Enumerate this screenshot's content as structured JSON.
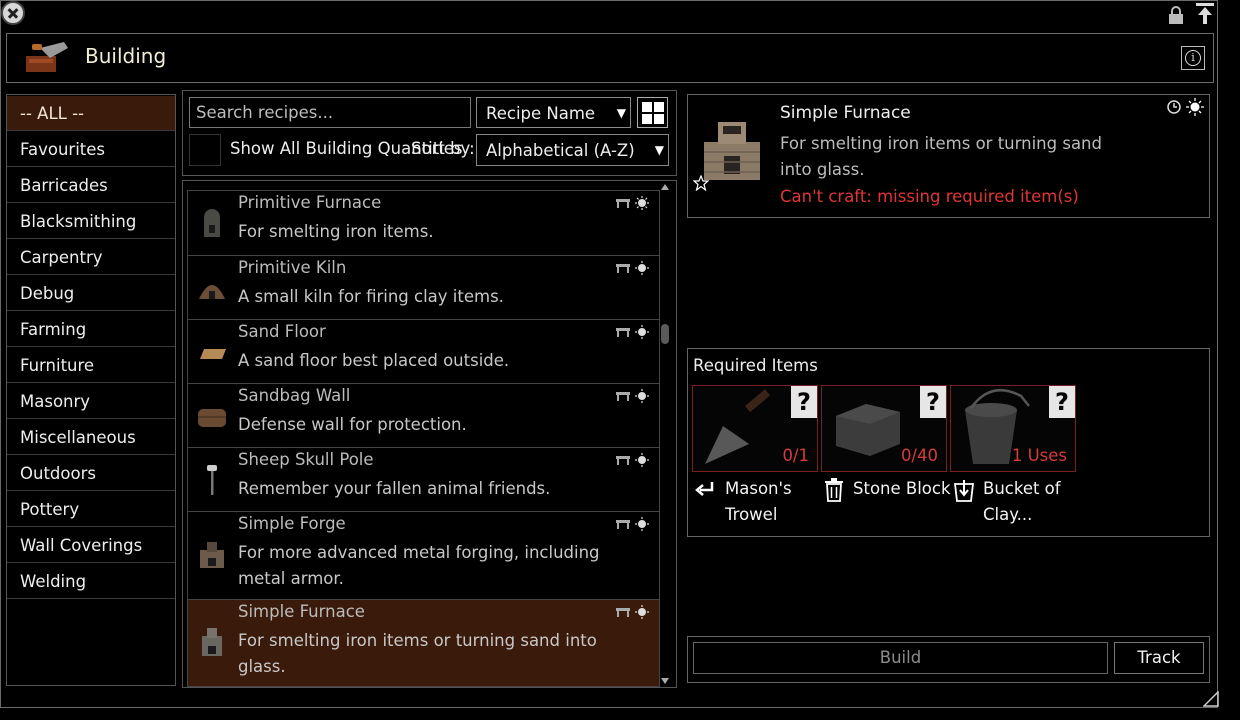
{
  "window": {
    "title": "Building",
    "icons": [
      "close-icon",
      "lock-icon",
      "pin-icon",
      "info-icon",
      "trowel-brick-icon"
    ]
  },
  "categories": [
    {
      "label": "-- ALL --",
      "active": true
    },
    {
      "label": "Favourites"
    },
    {
      "label": "Barricades"
    },
    {
      "label": "Blacksmithing"
    },
    {
      "label": "Carpentry"
    },
    {
      "label": "Debug"
    },
    {
      "label": "Farming"
    },
    {
      "label": "Furniture"
    },
    {
      "label": "Masonry"
    },
    {
      "label": "Miscellaneous"
    },
    {
      "label": "Outdoors"
    },
    {
      "label": "Pottery"
    },
    {
      "label": "Wall Coverings"
    },
    {
      "label": "Welding"
    }
  ],
  "controls": {
    "search_placeholder": "Search recipes...",
    "filter_select": "Recipe Name",
    "show_all_label": "Show All Building Quantities",
    "sort_by_label": "Sort by:",
    "sort_select": "Alphabetical (A-Z)"
  },
  "recipes": [
    {
      "name": "Primitive Furnace",
      "desc": "For smelting iron items.",
      "icon": "furnace-icon"
    },
    {
      "name": "Primitive Kiln",
      "desc": "A small kiln for firing clay items.",
      "icon": "kiln-icon"
    },
    {
      "name": "Sand Floor",
      "desc": "A sand floor best placed outside.",
      "icon": "sand-floor-icon"
    },
    {
      "name": "Sandbag Wall",
      "desc": "Defense wall for protection.",
      "icon": "sandbag-icon"
    },
    {
      "name": "Sheep Skull Pole",
      "desc": "Remember your fallen animal friends.",
      "icon": "skull-pole-icon"
    },
    {
      "name": "Simple Forge",
      "desc": "For more advanced metal forging, including metal armor.",
      "icon": "forge-icon"
    },
    {
      "name": "Simple Furnace",
      "desc": "For smelting iron items or turning sand into glass.",
      "icon": "furnace-icon",
      "selected": true
    }
  ],
  "detail": {
    "name": "Simple Furnace",
    "desc": "For smelting iron items or turning sand into glass.",
    "error": "Can't craft: missing required item(s)",
    "error_color": "#e03535"
  },
  "required": {
    "title": "Required Items",
    "items": [
      {
        "name": "Mason's Trowel",
        "count": "0/1",
        "badge": "?",
        "icon": "trowel-icon",
        "label_icon": "return-arrow-icon"
      },
      {
        "name": "Stone Block",
        "count": "0/40",
        "badge": "?",
        "icon": "stone-block-icon",
        "label_icon": "trash-icon"
      },
      {
        "name": "Bucket of Clay...",
        "count": "1 Uses",
        "badge": "?",
        "icon": "bucket-icon",
        "label_icon": "bucket-down-icon"
      }
    ]
  },
  "actions": {
    "build": "Build",
    "track": "Track"
  },
  "colors": {
    "selected_bg": "#3a1a0a",
    "border": "#666666",
    "missing": "#d43b3b"
  }
}
